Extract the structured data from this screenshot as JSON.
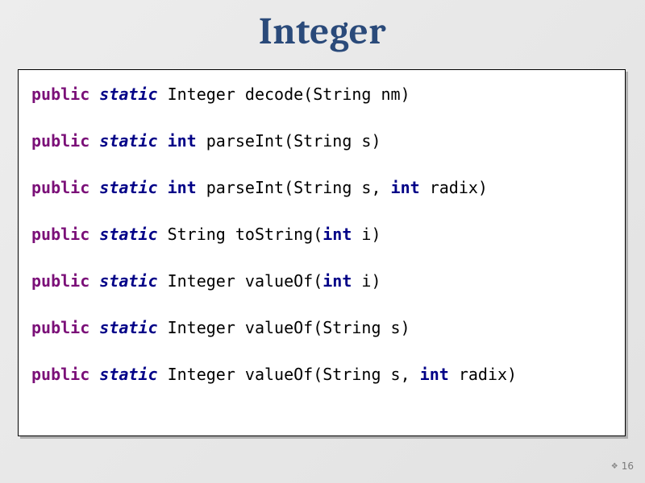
{
  "title": "Integer",
  "page_number": "16",
  "code": {
    "lines": [
      {
        "pre": "",
        "access": "public",
        "sp1": " ",
        "static": "static",
        "sp2": " ",
        "ret_kind": "plain",
        "ret": "Integer",
        "sp3": " ",
        "name": "decode",
        "params": [
          {
            "kind": "plain",
            "text": "String nm"
          }
        ]
      },
      {
        "pre": "",
        "access": "public",
        "sp1": " ",
        "static": "static",
        "sp2": " ",
        "ret_kind": "kw",
        "ret": "int",
        "sp3": " ",
        "name": "parseInt",
        "params": [
          {
            "kind": "plain",
            "text": "String s"
          }
        ]
      },
      {
        "pre": "",
        "access": "public",
        "sp1": " ",
        "static": "static",
        "sp2": " ",
        "ret_kind": "kw",
        "ret": "int",
        "sp3": " ",
        "name": "parseInt",
        "params": [
          {
            "kind": "plain",
            "text": "String s, "
          },
          {
            "kind": "kw",
            "text": "int"
          },
          {
            "kind": "plain",
            "text": " radix"
          }
        ]
      },
      {
        "pre": "",
        "access": "public",
        "sp1": " ",
        "static": "static",
        "sp2": " ",
        "ret_kind": "plain",
        "ret": "String",
        "sp3": " ",
        "name": "toString",
        "params": [
          {
            "kind": "kw",
            "text": "int"
          },
          {
            "kind": "plain",
            "text": " i"
          }
        ]
      },
      {
        "pre": "",
        "access": "public",
        "sp1": " ",
        "static": "static",
        "sp2": " ",
        "ret_kind": "plain",
        "ret": "Integer",
        "sp3": " ",
        "name": "valueOf",
        "params": [
          {
            "kind": "kw",
            "text": "int"
          },
          {
            "kind": "plain",
            "text": " i"
          }
        ]
      },
      {
        "pre": "",
        "access": "public",
        "sp1": " ",
        "static": "static",
        "sp2": " ",
        "ret_kind": "plain",
        "ret": "Integer",
        "sp3": " ",
        "name": "valueOf",
        "params": [
          {
            "kind": "plain",
            "text": "String s"
          }
        ]
      },
      {
        "pre": "",
        "access": "public",
        "sp1": " ",
        "static": "static",
        "sp2": " ",
        "ret_kind": "plain",
        "ret": "Integer",
        "sp3": " ",
        "name": "valueOf",
        "params": [
          {
            "kind": "plain",
            "text": "String s, "
          },
          {
            "kind": "kw",
            "text": "int"
          },
          {
            "kind": "plain",
            "text": " radix"
          }
        ]
      }
    ]
  }
}
